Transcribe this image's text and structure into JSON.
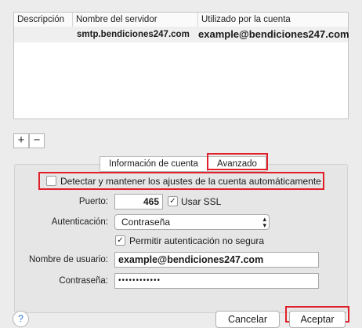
{
  "servers_table": {
    "headers": [
      "Descripción",
      "Nombre del servidor",
      "Utilizado por la cuenta"
    ],
    "rows": [
      {
        "description": "",
        "server": "smtp.bendiciones247.com",
        "account": "example@bendiciones247.com"
      }
    ]
  },
  "list_controls": {
    "add": "+",
    "remove": "−"
  },
  "tabs": [
    {
      "label": "Información de cuenta",
      "selected": false
    },
    {
      "label": "Avanzado",
      "selected": true
    }
  ],
  "advanced": {
    "auto_detect_label": "Detectar y mantener los ajustes de la cuenta automáticamente",
    "auto_detect_checked": false,
    "port_label": "Puerto:",
    "port_value": "465",
    "use_ssl_label": "Usar SSL",
    "use_ssl_checked": true,
    "auth_label": "Autenticación:",
    "auth_value": "Contraseña",
    "insecure_auth_label": "Permitir autenticación no segura",
    "insecure_auth_checked": true,
    "username_label": "Nombre de usuario:",
    "username_value": "example@bendiciones247.com",
    "password_label": "Contraseña:",
    "password_value": "••••••••••••"
  },
  "footer": {
    "help": "?",
    "cancel": "Cancelar",
    "accept": "Aceptar"
  },
  "colors": {
    "highlight": "#e0202a",
    "link_blue": "#2a6ed8"
  }
}
